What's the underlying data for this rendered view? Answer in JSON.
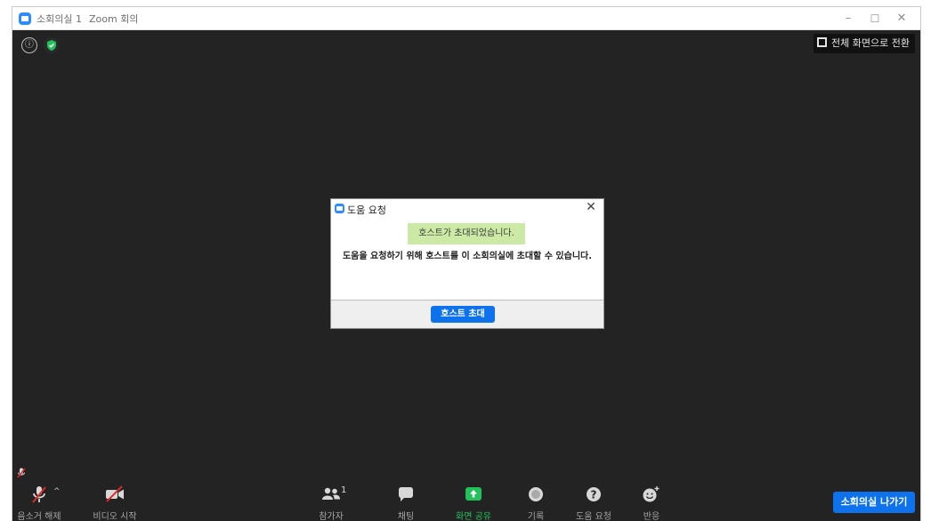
{
  "window": {
    "title": "소회의실 1",
    "app_name": "Zoom 회의",
    "controls": {
      "minimize": "–",
      "maximize": "☐",
      "close": "✕"
    }
  },
  "top_bar": {
    "info_icon": "ⓘ",
    "fullscreen_label": "전체 화면으로 전환"
  },
  "dialog": {
    "title": "도움 요청",
    "close": "✕",
    "notice": "호스트가 초대되었습니다.",
    "message": "도움을 요청하기 위해 호스트를 이 소회의실에 초대할 수 있습니다.",
    "invite_button": "호스트 초대"
  },
  "toolbar": {
    "unmute": "음소거 해제",
    "start_video": "비디오 시작",
    "participants": "참가자",
    "participant_count": "1",
    "chat": "채팅",
    "share_screen": "화면 공유",
    "record": "기록",
    "ask_for_help": "도움 요청",
    "reactions": "반응",
    "leave_room": "소회의실 나가기",
    "caret": "^"
  },
  "colors": {
    "accent": "#0e72ed",
    "meeting_bg": "#232323",
    "share_green": "#22c15b",
    "notice_bg": "#cde9a6",
    "muted_red": "#e02828"
  }
}
